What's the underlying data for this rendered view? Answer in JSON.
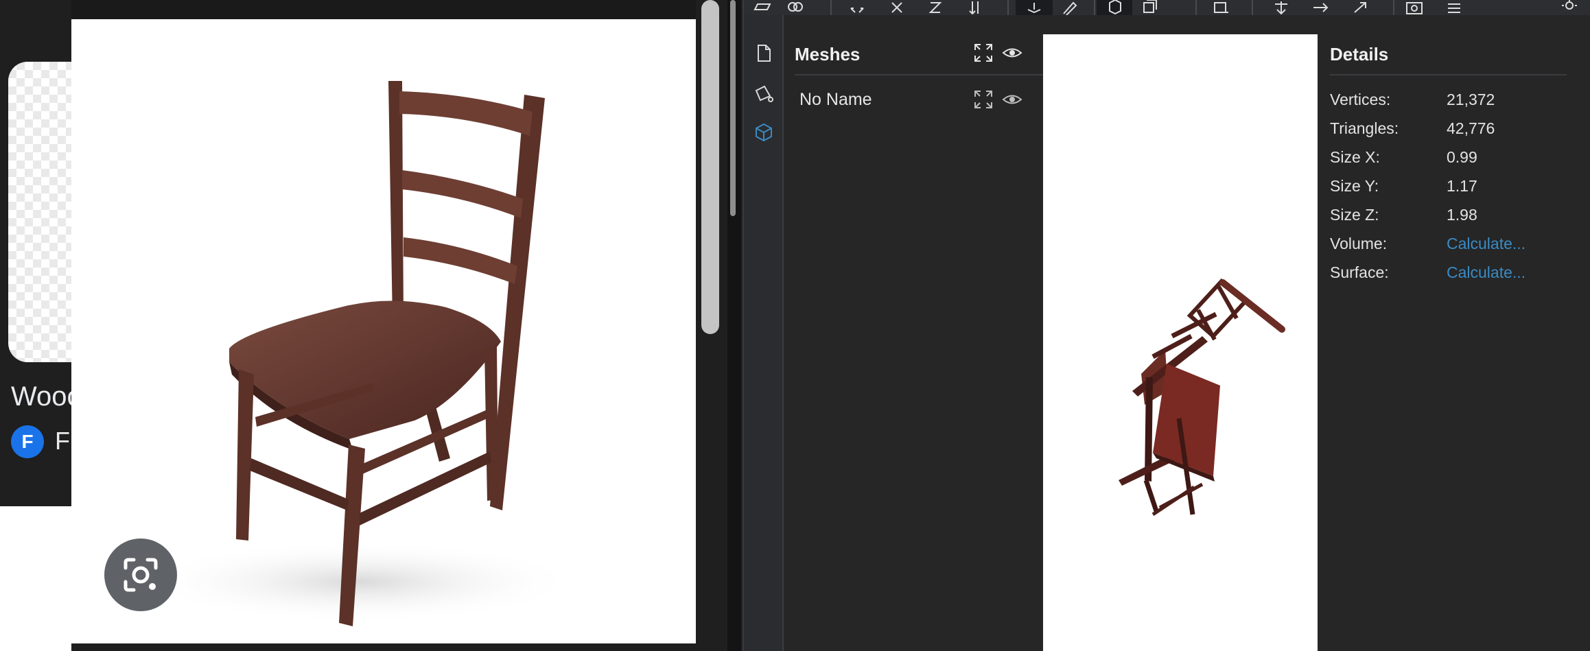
{
  "left_page": {
    "result_title": "Wooc",
    "source_favicon_letter": "F",
    "source_name": "F"
  },
  "icons": {
    "lens_button": "google-lens-icon",
    "source_favicon": "favicon-icon"
  },
  "app": {
    "toolbar": {
      "icons": [
        "open-folder-icon",
        "link-icon",
        "fit-all-icon",
        "axis-x-icon",
        "axis-z-icon",
        "swap-vertical-icon",
        "ground-plane-icon",
        "pen-icon",
        "cube-solid-icon",
        "cube-wire-icon",
        "snapshot-box-icon",
        "move-down-icon",
        "move-right-icon",
        "move-diagonal-icon",
        "camera-icon",
        "grid-icon",
        "sun-icon"
      ]
    },
    "sidebar": {
      "icons": [
        "file-icon",
        "mesh-edit-icon",
        "cube-icon"
      ]
    },
    "meshes": {
      "title": "Meshes",
      "items": [
        {
          "name": "No Name"
        }
      ]
    },
    "details": {
      "title": "Details",
      "rows": [
        {
          "label": "Vertices:",
          "value": "21,372"
        },
        {
          "label": "Triangles:",
          "value": "42,776"
        },
        {
          "label": "Size X:",
          "value": "0.99"
        },
        {
          "label": "Size Y:",
          "value": "1.17"
        },
        {
          "label": "Size Z:",
          "value": "1.98"
        },
        {
          "label": "Volume:",
          "value": "Calculate..."
        },
        {
          "label": "Surface:",
          "value": "Calculate..."
        }
      ]
    },
    "colors": {
      "accent": "#3a8bc4",
      "background": "#262626",
      "chair_wood": "#5a2b22"
    }
  }
}
